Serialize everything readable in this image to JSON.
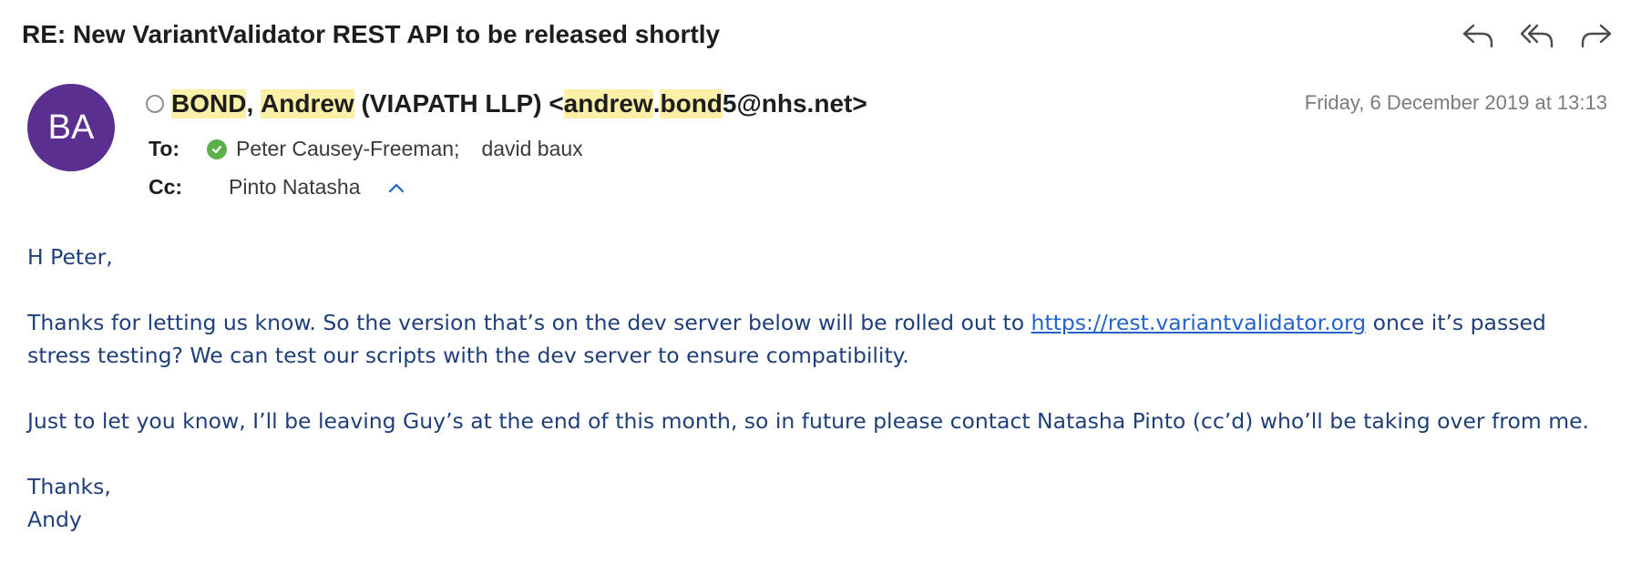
{
  "email": {
    "subject": "RE: New VariantValidator REST API to be released shortly",
    "actions": {
      "reply_icon": "reply-icon",
      "reply_all_icon": "reply-all-icon",
      "forward_icon": "forward-icon"
    },
    "avatar_initials": "BA",
    "avatar_color": "#5b2f8f",
    "from": {
      "surname": "BOND",
      "comma": ", ",
      "given_name": "Andrew",
      "org": " (VIAPATH LLP) <",
      "email_user": "andrew",
      "email_dot": ".",
      "email_user2": "bond",
      "email_rest": "5@nhs.net>"
    },
    "date": "Friday, 6 December 2019 at 13:13",
    "to_label": "To:",
    "to_recipients": [
      "Peter Causey-Freeman;",
      "david baux"
    ],
    "cc_label": "Cc:",
    "cc_recipients": [
      "Pinto Natasha"
    ],
    "body": {
      "greeting": "H Peter,",
      "p1_before": "Thanks for letting us know. So the version that’s on the dev server below will be rolled out to ",
      "p1_link": "https://rest.variantvalidator.org",
      "p1_after": " once it’s passed stress testing? We can test our scripts with the dev server to ensure compatibility.",
      "p2": "Just to let you know, I’ll be leaving Guy’s at the end of this month, so in future please contact Natasha Pinto (cc’d) who’ll be taking over from me.",
      "signoff": "Thanks,",
      "signature": "Andy"
    },
    "colors": {
      "highlight": "#fbf0a6",
      "body_text": "#1f3f7a",
      "link": "#2463c8",
      "verified": "#5bb04a"
    }
  }
}
